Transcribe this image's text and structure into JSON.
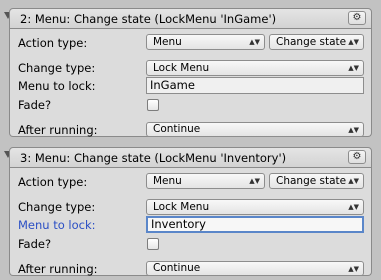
{
  "panels": [
    {
      "title": "2: Menu: Change state (LockMenu 'InGame')",
      "gear_icon": "⚙",
      "action_type_label": "Action type:",
      "action_category": "Menu",
      "action_name": "Change state",
      "change_type_label": "Change type:",
      "change_type": "Lock Menu",
      "menu_label": "Menu to lock:",
      "menu_value": "InGame",
      "fade_label": "Fade?",
      "after_label": "After running:",
      "after_value": "Continue"
    },
    {
      "title": "3: Menu: Change state (LockMenu 'Inventory')",
      "gear_icon": "⚙",
      "action_type_label": "Action type:",
      "action_category": "Menu",
      "action_name": "Change state",
      "change_type_label": "Change type:",
      "change_type": "Lock Menu",
      "menu_label": "Menu to lock:",
      "menu_value": "Inventory",
      "fade_label": "Fade?",
      "after_label": "After running:",
      "after_value": "Continue"
    }
  ],
  "dropdown_arrow": "▲▼",
  "colors": {
    "active_label": "#2b4fc4",
    "focus_border": "#5a86c9"
  }
}
